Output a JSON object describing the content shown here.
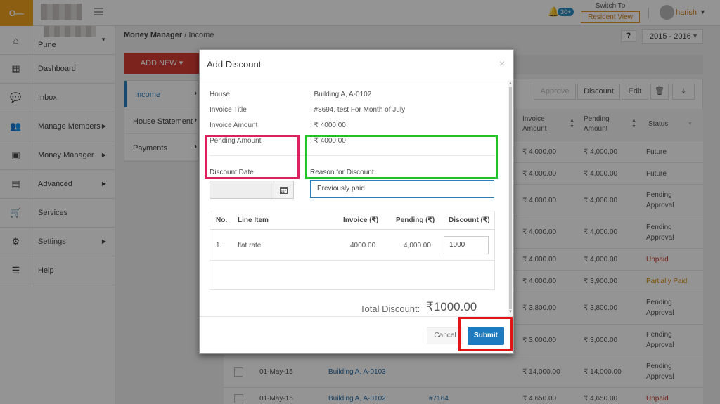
{
  "topbar": {
    "switch_to": "Switch To",
    "resident_view": "Resident View",
    "notification_count": "30+",
    "user_name": "harish"
  },
  "sidebar": {
    "society_city": "Pune",
    "items": [
      {
        "label": "Dashboard",
        "icon": "grid-icon"
      },
      {
        "label": "Inbox",
        "icon": "chat-icon"
      },
      {
        "label": "Manage Members",
        "icon": "users-icon"
      },
      {
        "label": "Money Manager",
        "icon": "money-icon"
      },
      {
        "label": "Advanced",
        "icon": "table-icon"
      },
      {
        "label": "Services",
        "icon": "cart-icon"
      },
      {
        "label": "Settings",
        "icon": "gear-icon"
      },
      {
        "label": "Help",
        "icon": "list-icon"
      }
    ]
  },
  "page": {
    "breadcrumb_section": "Money Manager",
    "breadcrumb_separator": " / ",
    "breadcrumb_page": "Income",
    "help_label": "?",
    "year": "2015 - 2016",
    "add_new": "ADD NEW ▾",
    "subnav": [
      "Income",
      "House Statement",
      "Payments"
    ]
  },
  "actions": {
    "approve": "Approve",
    "discount": "Discount",
    "edit": "Edit"
  },
  "table": {
    "headers": {
      "invoice_amount": "Invoice Amount",
      "pending_amount": "Pending Amount",
      "status": "Status"
    },
    "rows": [
      {
        "invoice": "₹ 4,000.00",
        "pending": "₹ 4,000.00",
        "status": "Future"
      },
      {
        "invoice": "₹ 4,000.00",
        "pending": "₹ 4,000.00",
        "status": "Future"
      },
      {
        "invoice": "₹ 4,000.00",
        "pending": "₹ 4,000.00",
        "status": "Pending Approval"
      },
      {
        "invoice": "₹ 4,000.00",
        "pending": "₹ 4,000.00",
        "status": "Pending Approval"
      },
      {
        "invoice": "₹ 4,000.00",
        "pending": "₹ 4,000.00",
        "status": "Unpaid"
      },
      {
        "invoice": "₹ 4,000.00",
        "pending": "₹ 3,900.00",
        "status": "Partially Paid"
      },
      {
        "invoice": "₹ 3,800.00",
        "pending": "₹ 3,800.00",
        "status": "Pending Approval"
      },
      {
        "invoice": "₹ 3,000.00",
        "pending": "₹ 3,000.00",
        "status": "Pending Approval"
      },
      {
        "date": "01-May-15",
        "house": "Building A, A-0103",
        "invoice": "₹ 14,000.00",
        "pending": "₹ 14,000.00",
        "status": "Pending Approval"
      },
      {
        "date": "01-May-15",
        "house": "Building A, A-0102",
        "invoice_no": "#7164",
        "invoice": "₹ 4,650.00",
        "pending": "₹ 4,650.00",
        "status": "Unpaid"
      }
    ]
  },
  "modal": {
    "title": "Add Discount",
    "close": "×",
    "info": [
      {
        "label": "House",
        "value": ": Building A, A-0102"
      },
      {
        "label": "Invoice Title",
        "value": ": #8694,  test For Month of July"
      },
      {
        "label": "Invoice Amount",
        "value": ": ₹ 4000.00"
      },
      {
        "label": "Pending Amount",
        "value": ": ₹ 4000.00"
      }
    ],
    "discount_date_label": "Discount Date",
    "discount_date_value": "",
    "reason_label": "Reason for Discount",
    "reason_value": "Previously paid",
    "line_items": {
      "headers": {
        "no": "No.",
        "line_item": "Line Item",
        "invoice": "Invoice (₹)",
        "pending": "Pending (₹)",
        "discount": "Discount (₹)"
      },
      "rows": [
        {
          "no": "1.",
          "line_item": "flat rate",
          "invoice": "4000.00",
          "pending": "4,000.00",
          "discount": "1000"
        }
      ]
    },
    "total_label": "Total Discount:",
    "total_value": "₹1000.00",
    "cancel": "Cancel",
    "submit": "Submit"
  },
  "colors": {
    "accent": "#1f7bc0",
    "add_new": "#d73d32",
    "highlight_date": "#e0215f",
    "highlight_reason": "#22c229",
    "highlight_submit": "#e11515"
  }
}
